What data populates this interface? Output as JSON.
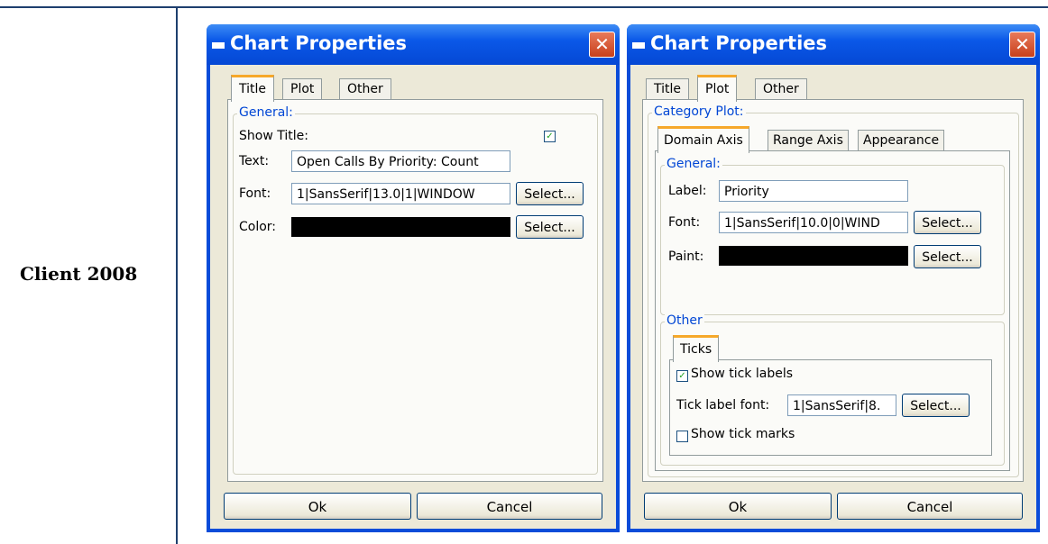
{
  "row_label": "Client 2008",
  "left_dialog": {
    "title": "Chart Properties",
    "close_glyph": "✕",
    "tabs": [
      "Title",
      "Plot",
      "Other"
    ],
    "general": {
      "legend": "General:",
      "show_title_label": "Show Title:",
      "show_title_checked": true,
      "text_label": "Text:",
      "text_value": "Open Calls By Priority: Count",
      "font_label": "Font:",
      "font_value": "1|SansSerif|13.0|1|WINDOW",
      "color_label": "Color:",
      "color_value": "#000000",
      "select_label": "Select..."
    },
    "ok_label": "Ok",
    "cancel_label": "Cancel"
  },
  "right_dialog": {
    "title": "Chart Properties",
    "close_glyph": "✕",
    "tabs": [
      "Title",
      "Plot",
      "Other"
    ],
    "category_plot_legend": "Category Plot:",
    "sub_tabs": [
      "Domain Axis",
      "Range Axis",
      "Appearance"
    ],
    "general": {
      "legend": "General:",
      "label_label": "Label:",
      "label_value": "Priority",
      "font_label": "Font:",
      "font_value": "1|SansSerif|10.0|0|WIND",
      "paint_label": "Paint:",
      "paint_value": "#000000",
      "select_label": "Select..."
    },
    "other": {
      "legend": "Other",
      "ticks_tab": "Ticks",
      "show_tick_labels": "Show tick labels",
      "show_tick_labels_checked": true,
      "tick_font_label": "Tick label font:",
      "tick_font_value": "1|SansSerif|8.",
      "select_label": "Select...",
      "show_tick_marks": "Show tick marks",
      "show_tick_marks_checked": false
    },
    "ok_label": "Ok",
    "cancel_label": "Cancel"
  }
}
